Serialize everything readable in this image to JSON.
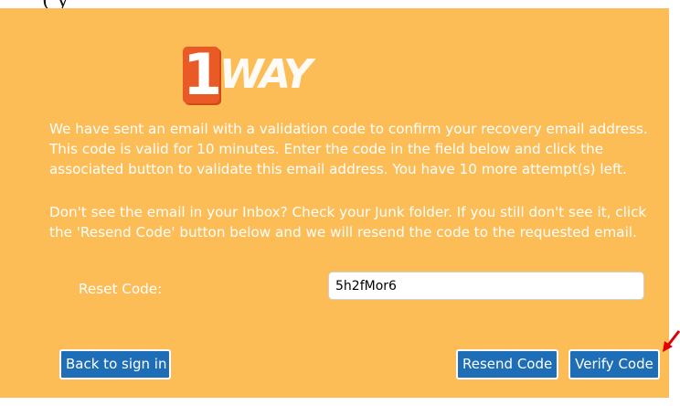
{
  "logo": {
    "mark": "1",
    "word": "WAY"
  },
  "message": {
    "paragraph1": "We have sent an email with a validation code to confirm your recovery email address. This code is valid for 10 minutes. Enter the code in the field below and click the associated button to validate this email address. You have 10 more attempt(s) left.",
    "paragraph2": "Don't see the email in your Inbox? Check your Junk folder. If you still don't see it, click the 'Resend Code' button below and we will resend the code to the requested email."
  },
  "form": {
    "reset_code_label": "Reset Code:",
    "reset_code_value": "5h2fMor6"
  },
  "buttons": {
    "back": "Back to sign in",
    "resend": "Resend Code",
    "verify": "Verify Code"
  },
  "colors": {
    "panel_background": "#fdbd56",
    "button_background": "#1e6eb7",
    "logo_accent": "#ea5a26",
    "annotation_arrow": "#e00000"
  },
  "icons": {
    "annotation": "red-arrow-icon"
  }
}
